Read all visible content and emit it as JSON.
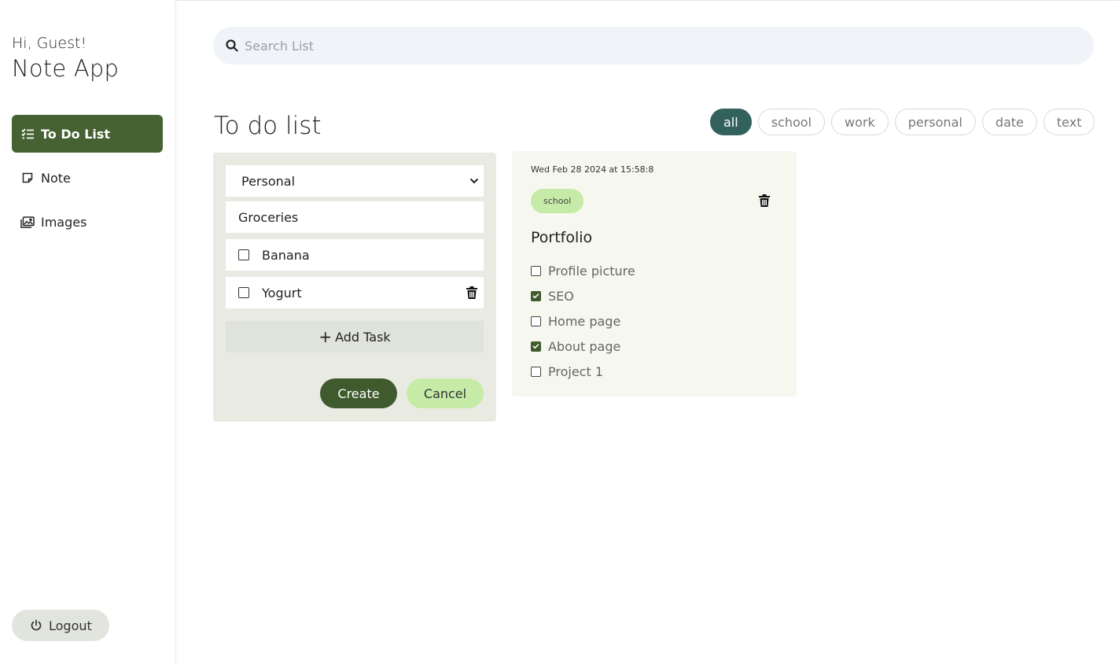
{
  "sidebar": {
    "greeting": "Hi, Guest!",
    "app_name": "Note App",
    "items": [
      {
        "label": "To Do List",
        "icon": "checklist-icon",
        "active": true
      },
      {
        "label": "Note",
        "icon": "note-icon",
        "active": false
      },
      {
        "label": "Images",
        "icon": "images-icon",
        "active": false
      }
    ],
    "logout_label": "Logout"
  },
  "search": {
    "placeholder": "Search List",
    "value": ""
  },
  "main": {
    "title": "To do list",
    "filters": [
      "all",
      "school",
      "work",
      "personal",
      "date",
      "text"
    ],
    "active_filter": "all"
  },
  "form": {
    "category": "Personal",
    "title_value": "Groceries",
    "tasks": [
      {
        "label": "Banana",
        "checked": false
      },
      {
        "label": "Yogurt",
        "checked": false
      }
    ],
    "add_task_label": "Add Task",
    "create_label": "Create",
    "cancel_label": "Cancel"
  },
  "card": {
    "date": "Wed Feb 28 2024 at 15:58:8",
    "tag": "school",
    "title": "Portfolio",
    "items": [
      {
        "label": "Profile picture",
        "checked": false
      },
      {
        "label": "SEO",
        "checked": true
      },
      {
        "label": "Home page",
        "checked": false
      },
      {
        "label": "About page",
        "checked": true
      },
      {
        "label": "Project 1",
        "checked": false
      }
    ]
  },
  "colors": {
    "sidebar_active": "#466232",
    "filter_active": "#33615e",
    "create_button": "#3f5b2d",
    "cancel_button": "#c5eba7",
    "tag": "#c6eba8"
  }
}
